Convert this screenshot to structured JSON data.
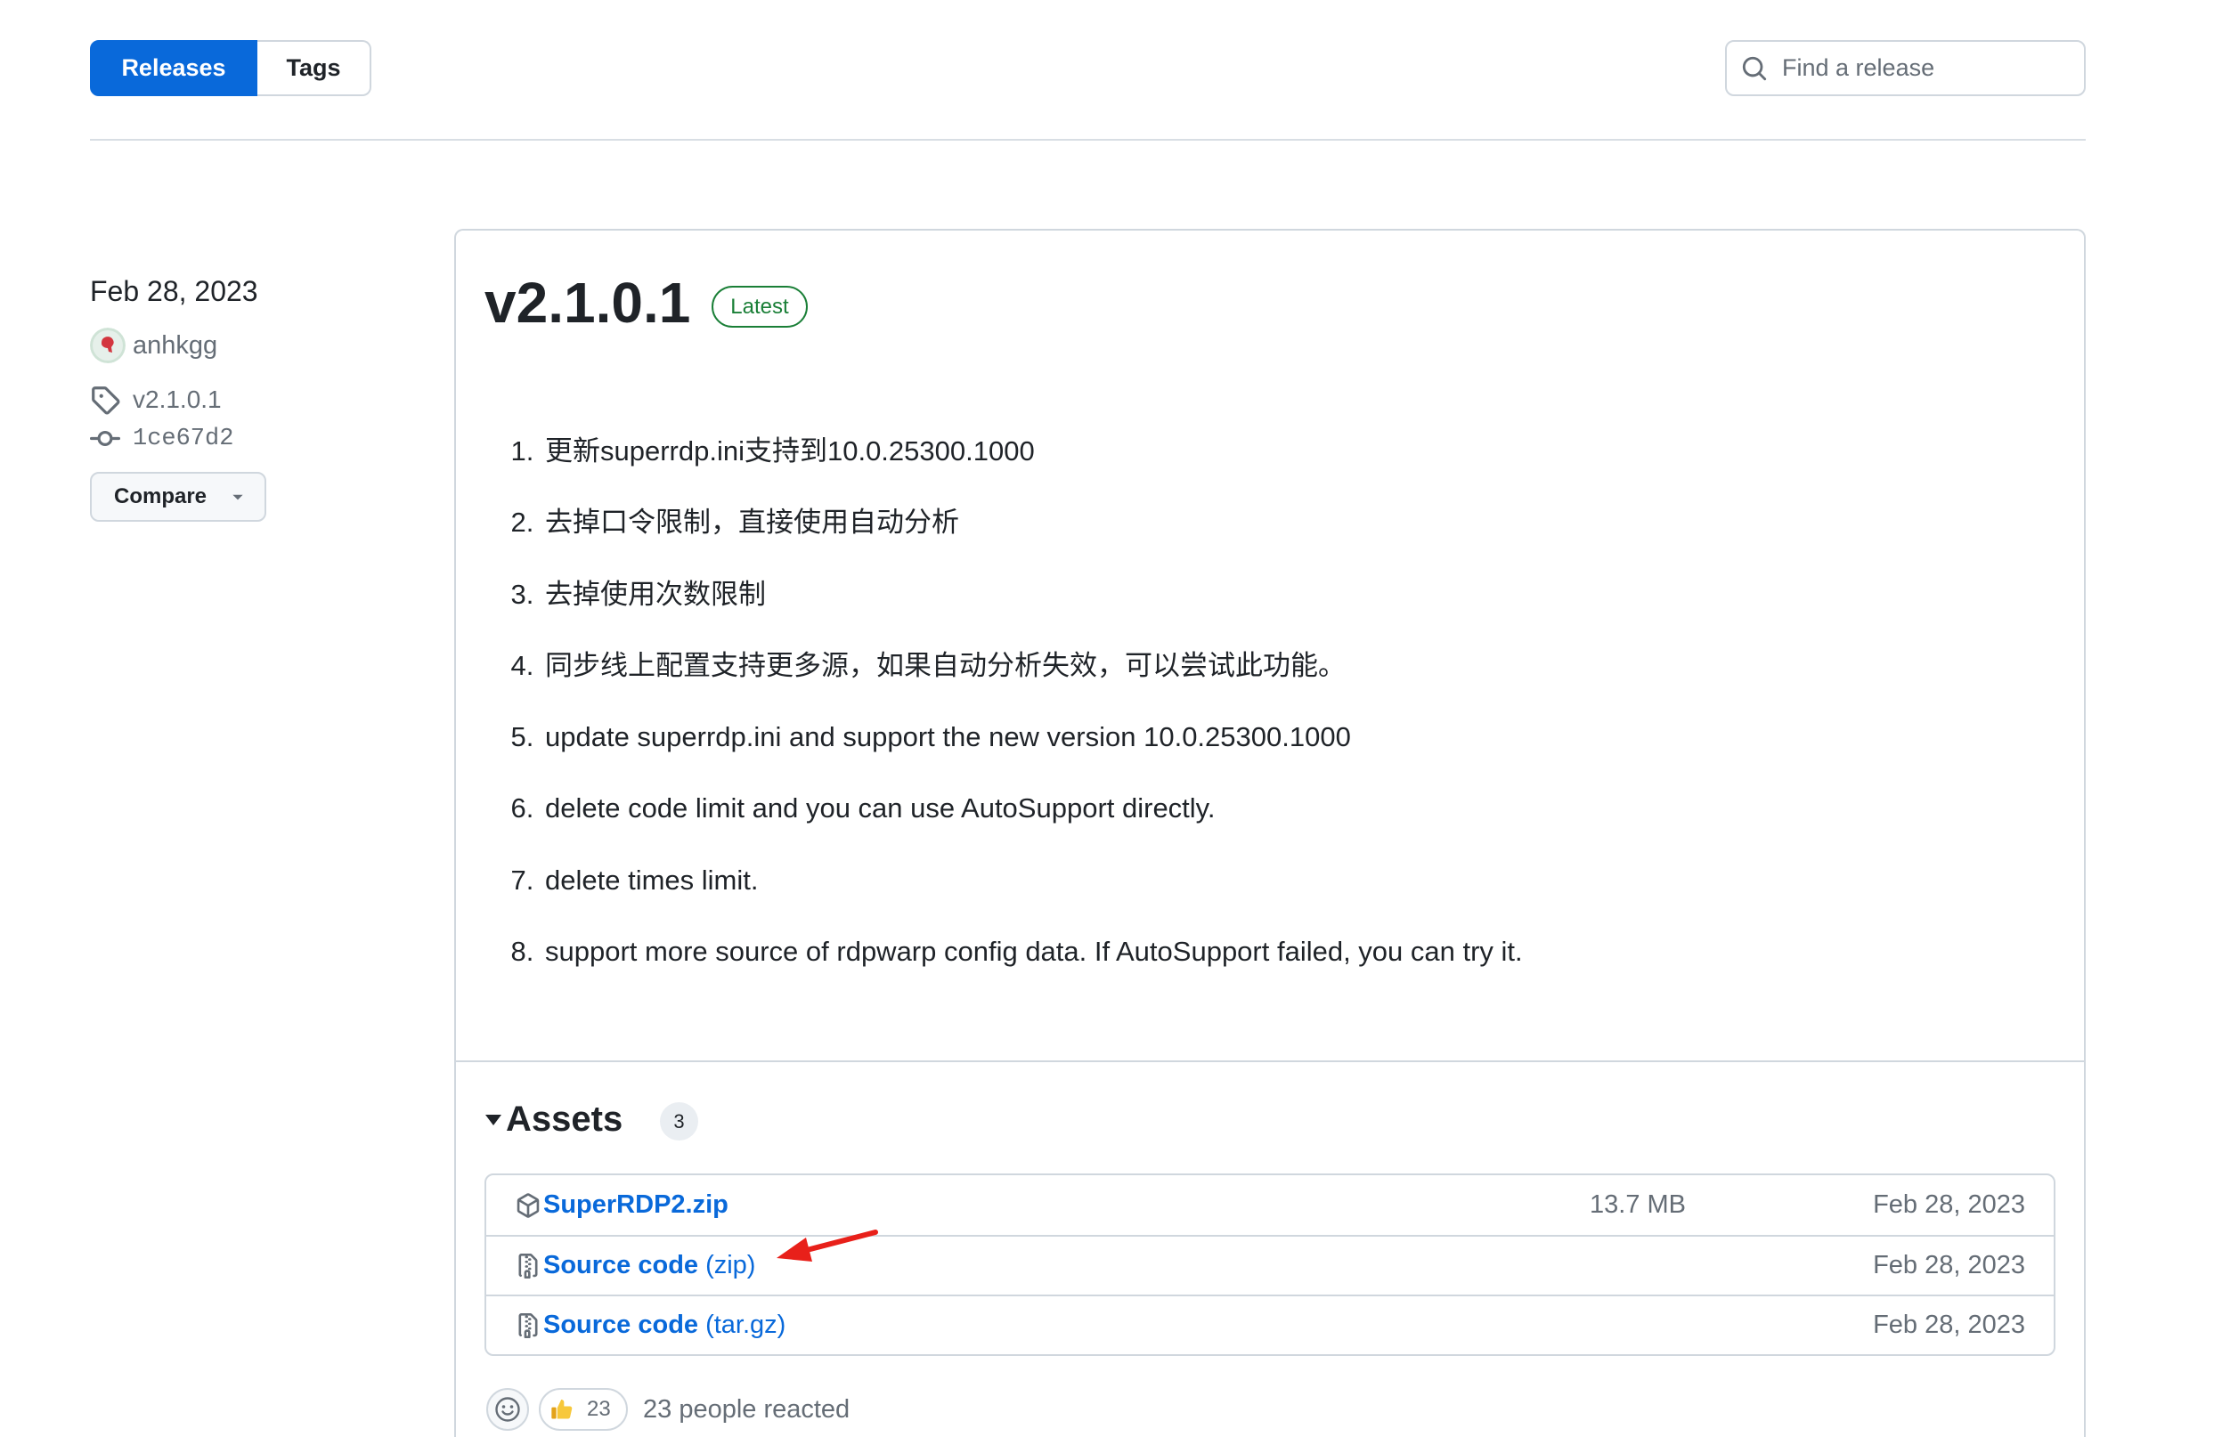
{
  "nav": {
    "tabs": [
      {
        "label": "Releases",
        "active": true
      },
      {
        "label": "Tags",
        "active": false
      }
    ],
    "search": {
      "placeholder": "Find a release",
      "icon": "search-icon"
    }
  },
  "release": {
    "date": "Feb 28, 2023",
    "author": "anhkgg",
    "tag": "v2.1.0.1",
    "commit": "1ce67d2",
    "compare_label": "Compare",
    "title": "v2.1.0.1",
    "badge": "Latest",
    "notes": [
      "更新superrdp.ini支持到10.0.25300.1000",
      "去掉口令限制，直接使用自动分析",
      "去掉使用次数限制",
      "同步线上配置支持更多源，如果自动分析失效，可以尝试此功能。",
      "update superrdp.ini and support the new version 10.0.25300.1000",
      "delete code limit and you can use AutoSupport directly.",
      "delete times limit.",
      "support more source of rdpwarp config data. If AutoSupport failed, you can try it."
    ],
    "assets": {
      "heading": "Assets",
      "count": "3",
      "items": [
        {
          "name": "SuperRDP2.zip",
          "size": "13.7 MB",
          "date": "Feb 28, 2023",
          "icon": "package-icon"
        },
        {
          "name": "Source code",
          "format": "(zip)",
          "date": "Feb 28, 2023",
          "icon": "file-zip-icon"
        },
        {
          "name": "Source code",
          "format": "(tar.gz)",
          "date": "Feb 28, 2023",
          "icon": "file-zip-icon"
        }
      ]
    },
    "reactions": {
      "thumbs_up_count": "23",
      "summary": "23 people reacted"
    }
  },
  "colors": {
    "accent": "#0969da",
    "latest_badge": "#1a7f37",
    "text": "#1f2328",
    "muted_text": "#656d76",
    "border": "#d0d7de",
    "annotation_arrow": "#e8201a"
  }
}
